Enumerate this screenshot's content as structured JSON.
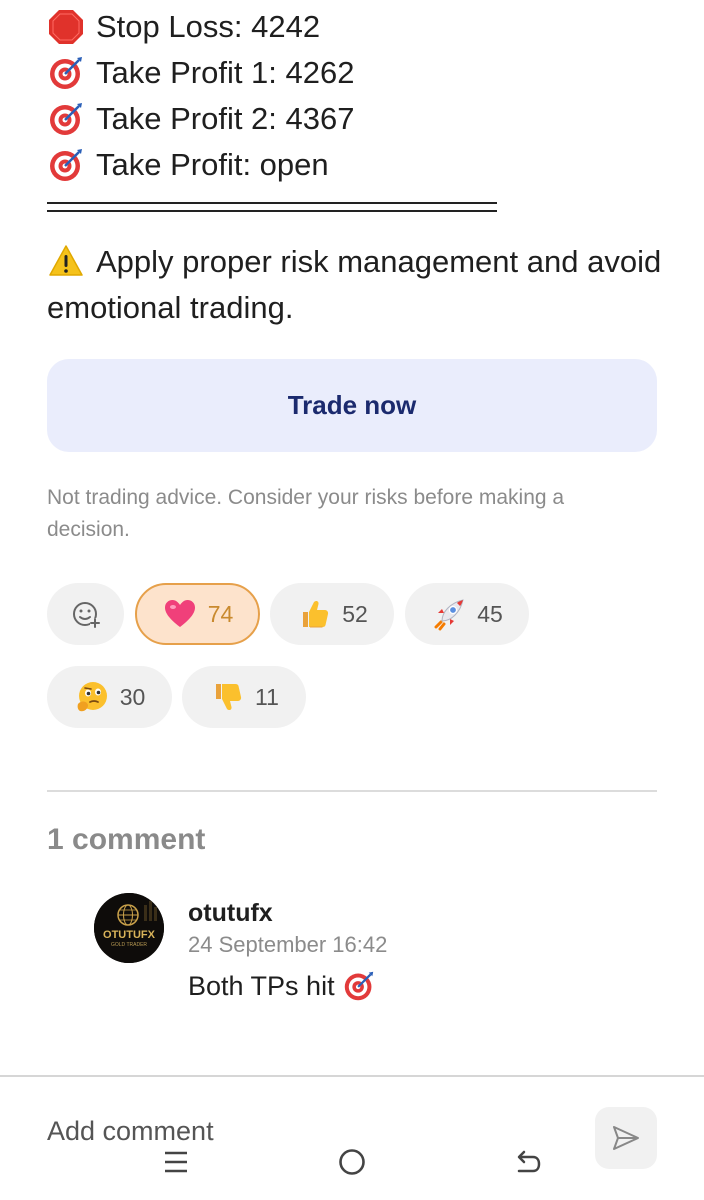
{
  "signal": {
    "stop_loss": "Stop Loss: 4242",
    "tp1": "Take Profit 1: 4262",
    "tp2": "Take Profit 2: 4367",
    "tp3": "Take Profit: open",
    "warning": "Apply proper risk management and avoid emotional trading."
  },
  "trade_button": "Trade now",
  "disclaimer": "Not trading advice. Consider your risks before making a decision.",
  "reactions": [
    {
      "icon": "add-reaction-icon",
      "count": ""
    },
    {
      "icon": "heart-icon",
      "count": "74"
    },
    {
      "icon": "thumbs-up-icon",
      "count": "52"
    },
    {
      "icon": "rocket-icon",
      "count": "45"
    },
    {
      "icon": "thinking-face-icon",
      "count": "30"
    },
    {
      "icon": "thumbs-down-icon",
      "count": "11"
    }
  ],
  "comments": {
    "title": "1 comment",
    "items": [
      {
        "author": "otutufx",
        "date": "24 September 16:42",
        "text": "Both TPs hit"
      }
    ],
    "avatar_text": "OTUTUFX",
    "avatar_subtext": "GOLD TRADER"
  },
  "composer": {
    "placeholder": "Add comment"
  },
  "colors": {
    "accent": "#1b2a6e",
    "button_bg": "#eaedfc",
    "reaction_active": "#fde3cc"
  }
}
